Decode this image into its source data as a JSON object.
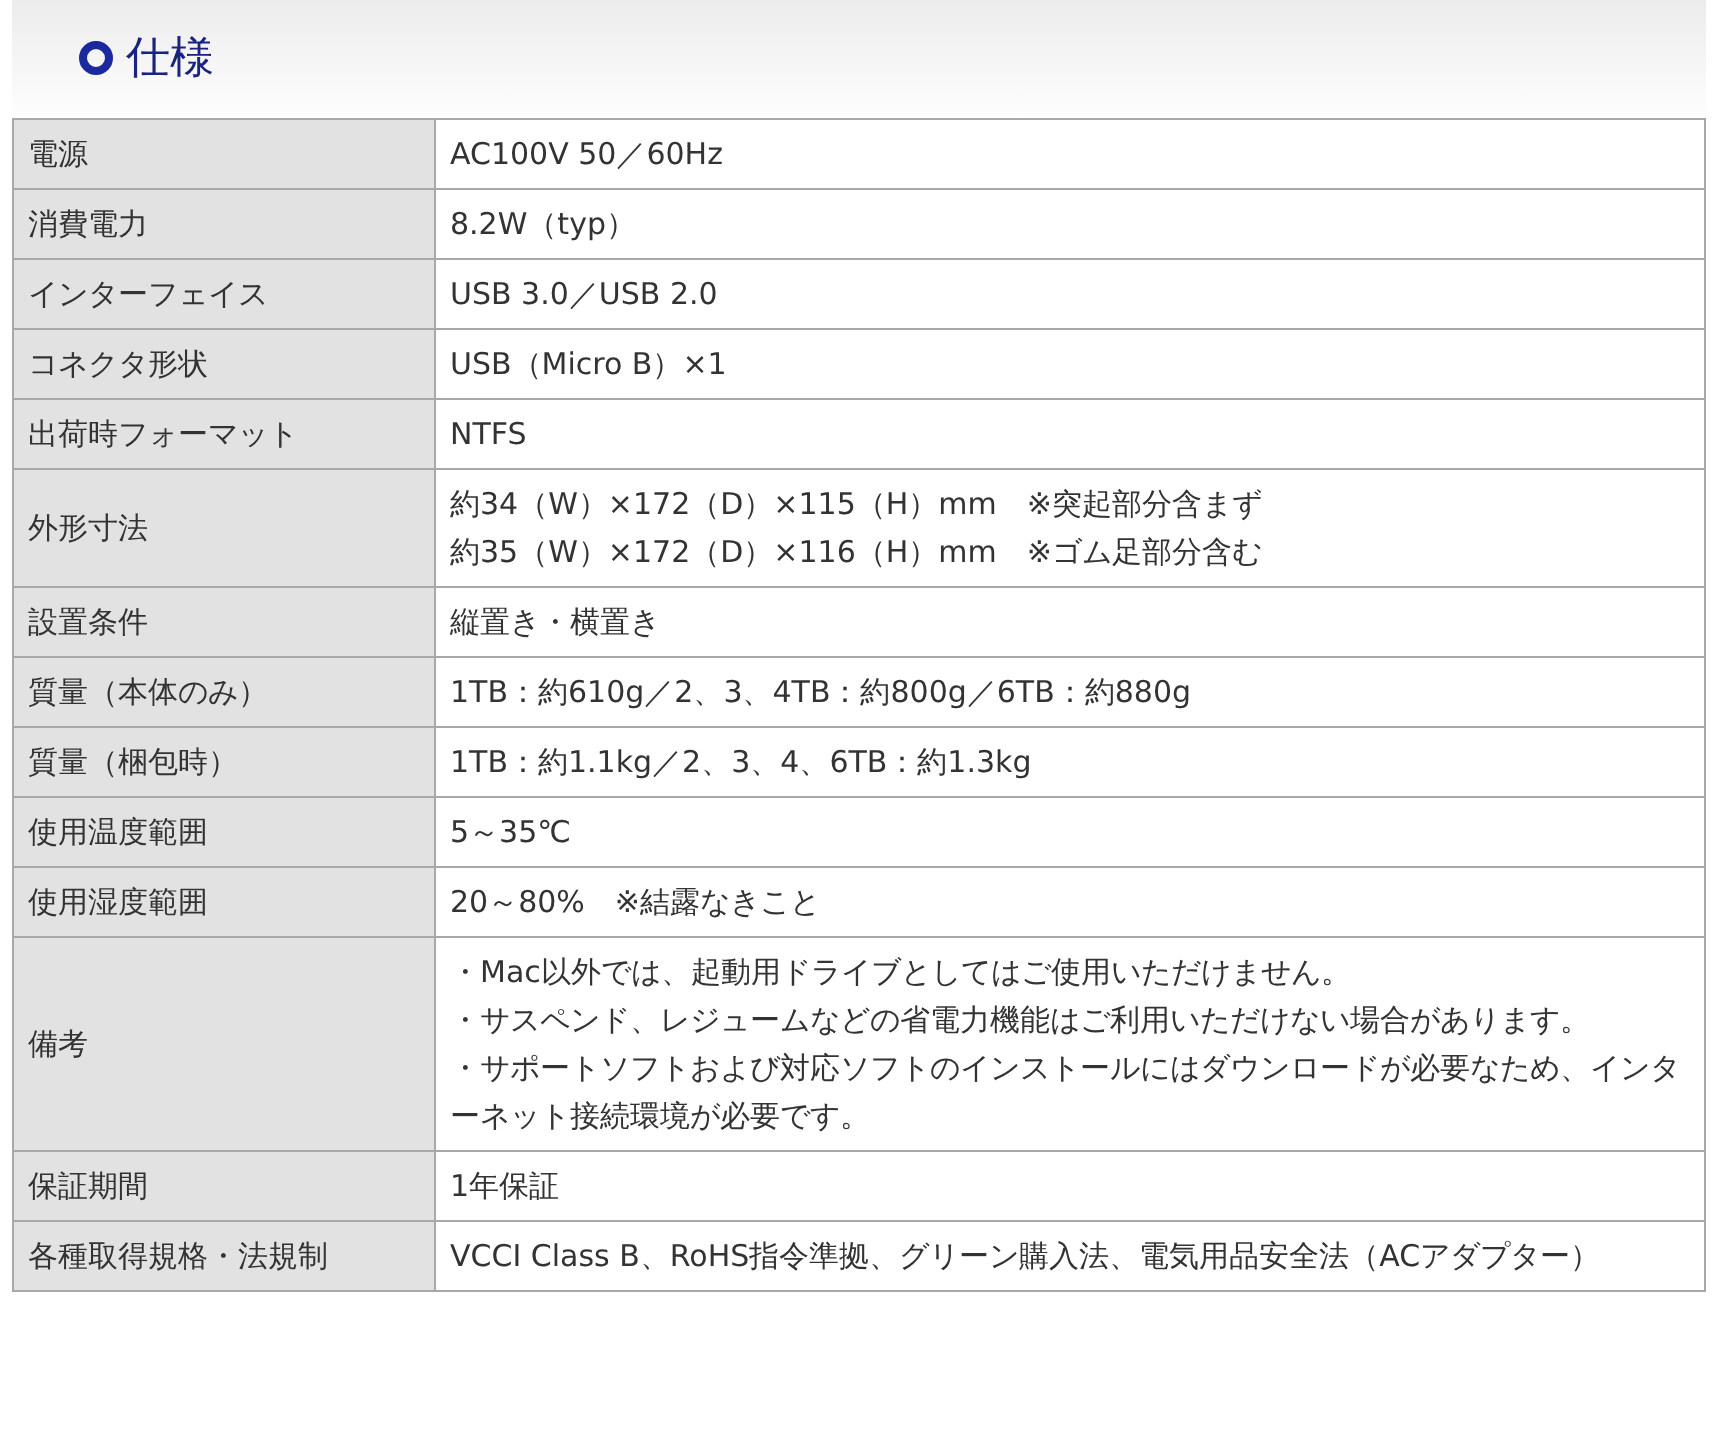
{
  "heading": "仕様",
  "rows": [
    {
      "label": "電源",
      "lines": [
        "AC100V 50／60Hz"
      ]
    },
    {
      "label": "消費電力",
      "lines": [
        "8.2W（typ）"
      ]
    },
    {
      "label": "インターフェイス",
      "lines": [
        "USB 3.0／USB 2.0"
      ]
    },
    {
      "label": "コネクタ形状",
      "lines": [
        "USB（Micro B）×1"
      ]
    },
    {
      "label": "出荷時フォーマット",
      "lines": [
        "NTFS"
      ]
    },
    {
      "label": "外形寸法",
      "lines": [
        "約34（W）×172（D）×115（H）mm　※突起部分含まず",
        "約35（W）×172（D）×116（H）mm　※ゴム足部分含む"
      ]
    },
    {
      "label": "設置条件",
      "lines": [
        "縦置き・横置き"
      ]
    },
    {
      "label": "質量（本体のみ）",
      "lines": [
        "1TB：約610g／2、3、4TB：約800g／6TB：約880g"
      ]
    },
    {
      "label": "質量（梱包時）",
      "lines": [
        "1TB：約1.1kg／2、3、4、6TB：約1.3kg"
      ]
    },
    {
      "label": "使用温度範囲",
      "lines": [
        "5～35℃"
      ]
    },
    {
      "label": "使用湿度範囲",
      "lines": [
        "20～80%　※結露なきこと"
      ]
    },
    {
      "label": "備考",
      "lines": [
        "・Mac以外では、起動用ドライブとしてはご使用いただけません。",
        "・サスペンド、レジュームなどの省電力機能はご利用いただけない場合があります。",
        "・サポートソフトおよび対応ソフトのインストールにはダウンロードが必要なため、インターネット接続環境が必要です。"
      ]
    },
    {
      "label": "保証期間",
      "lines": [
        "1年保証"
      ]
    },
    {
      "label": "各種取得規格・法規制",
      "lines": [
        "VCCI Class B、RoHS指令準拠、グリーン購入法、電気用品安全法（ACアダプター）"
      ]
    }
  ]
}
